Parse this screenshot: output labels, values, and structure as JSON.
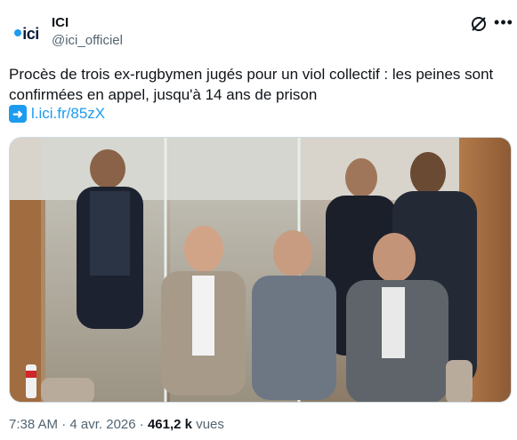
{
  "account": {
    "name": "ICI",
    "handle": "@ici_officiel",
    "logo_text": "ici"
  },
  "tweet": {
    "text": "Procès de trois ex-rugbymen jugés pour un viol collectif : les peines sont confirmées en appel, jusqu'à 14 ans de prison",
    "link": "l.ici.fr/85zX",
    "time": "7:38 AM",
    "date": "4 avr. 2026",
    "views": "461,2 k",
    "views_label": "vues",
    "separator": "·"
  },
  "icons": [
    "grok-icon",
    "more-icon",
    "arrow-right-icon"
  ],
  "colors": {
    "accent": "#1d9bf0",
    "text": "#0f1419",
    "muted": "#536471"
  }
}
